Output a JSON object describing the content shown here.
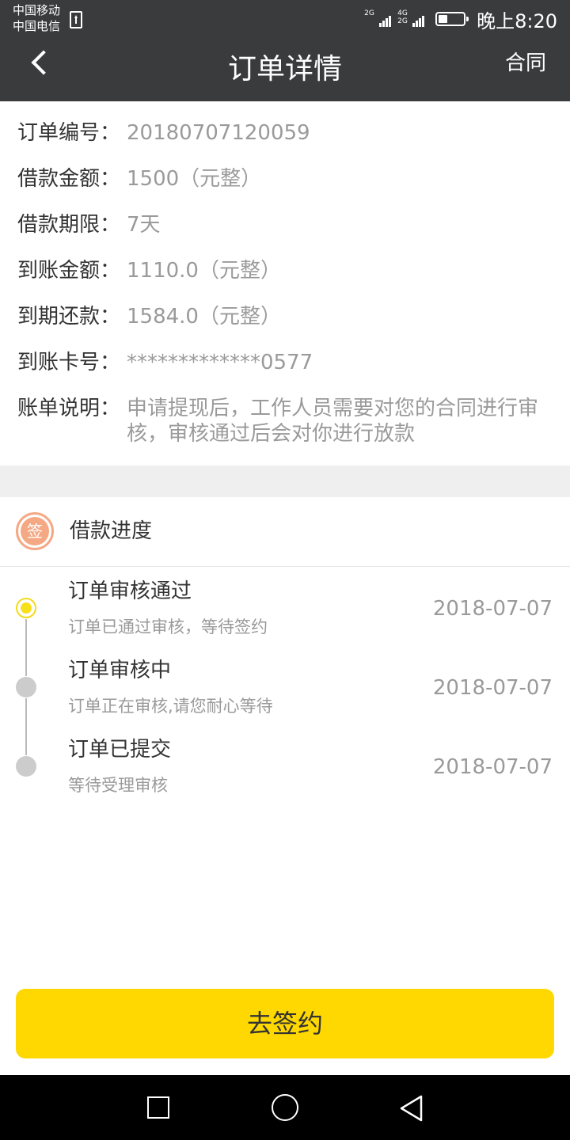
{
  "status_bar": {
    "carrier1": "中国移动",
    "carrier2": "中国电信",
    "sim1_label": "2G",
    "sim2_label_top": "4G",
    "sim2_label_bottom": "2G",
    "time": "晚上8:20",
    "battery_level": 0.35
  },
  "nav": {
    "title": "订单详情",
    "right_label": "合同"
  },
  "details": [
    {
      "label": "订单编号：",
      "value": "20180707120059"
    },
    {
      "label": "借款金额：",
      "value": "1500（元整）"
    },
    {
      "label": "借款期限：",
      "value": "7天"
    },
    {
      "label": "到账金额：",
      "value": "1110.0（元整）"
    },
    {
      "label": "到期还款：",
      "value": "1584.0（元整）"
    },
    {
      "label": "到账卡号：",
      "value": "*************0577"
    },
    {
      "label": "账单说明：",
      "value": "申请提现后，工作人员需要对您的合同进行审核，审核通过后会对你进行放款"
    }
  ],
  "progress": {
    "badge": "签",
    "title": "借款进度",
    "steps": [
      {
        "title": "订单审核通过",
        "desc": "订单已通过审核，等待签约",
        "date": "2018-07-07",
        "active": true
      },
      {
        "title": "订单审核中",
        "desc": "订单正在审核,请您耐心等待",
        "date": "2018-07-07",
        "active": false
      },
      {
        "title": "订单已提交",
        "desc": "等待受理审核",
        "date": "2018-07-07",
        "active": false
      }
    ]
  },
  "action": {
    "sign_label": "去签约"
  },
  "colors": {
    "header_bg": "#3a3b3d",
    "accent": "#fed800",
    "badge": "#f4a984"
  }
}
